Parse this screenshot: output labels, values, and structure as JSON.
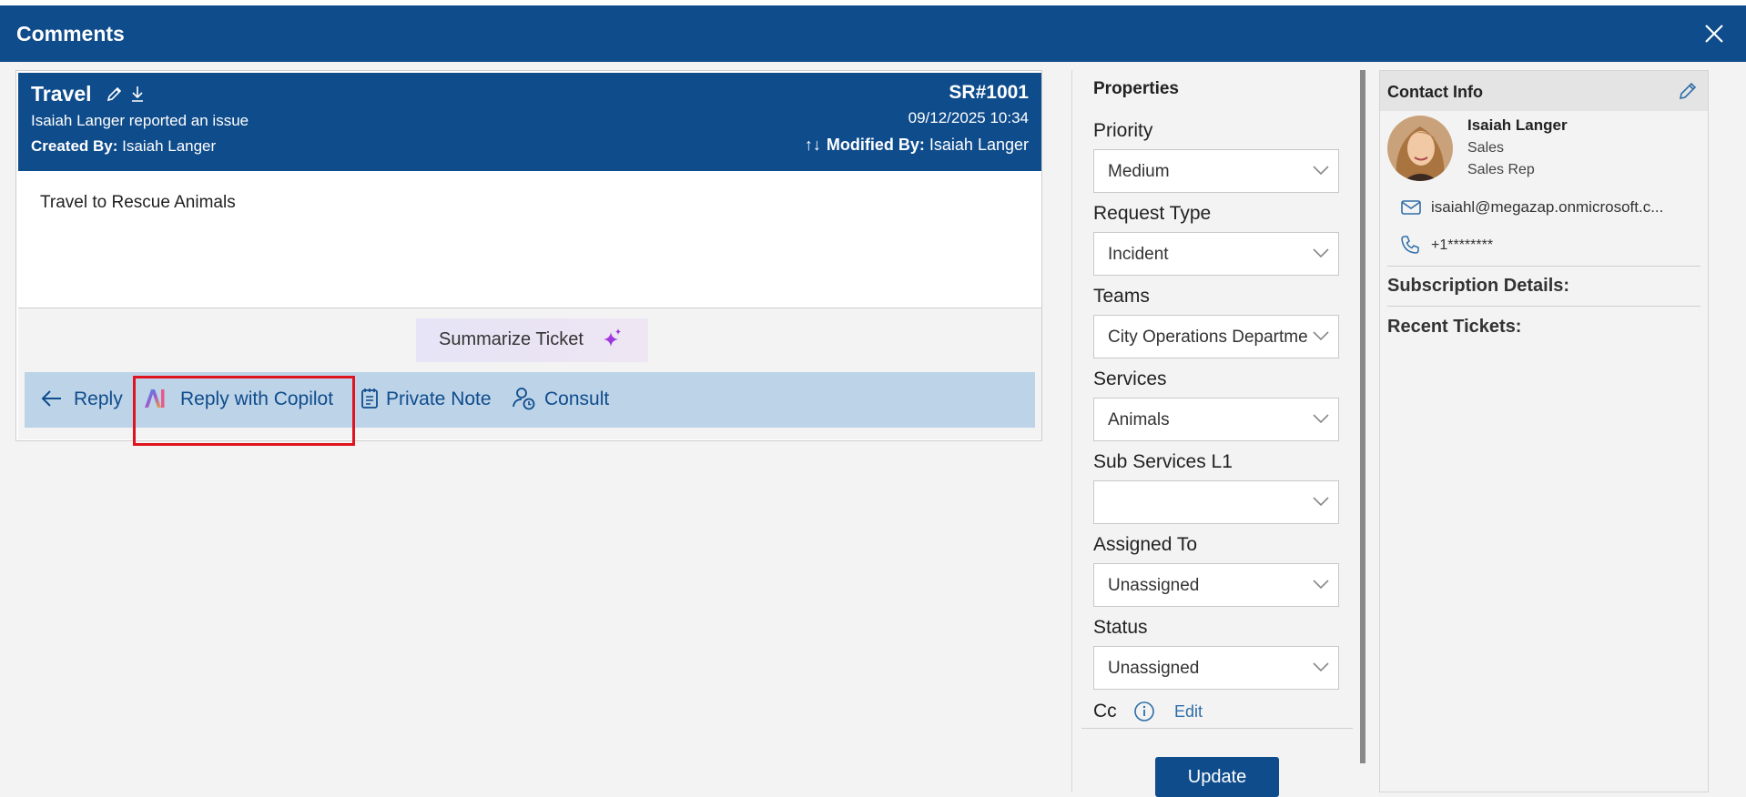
{
  "dialog": {
    "title": "Comments"
  },
  "ticket": {
    "title": "Travel",
    "reported": "Isaiah Langer reported an issue",
    "created_label": "Created By:",
    "created_by": "Isaiah Langer",
    "sr": "SR#1001",
    "date": "09/12/2025 10:34",
    "sort_arrows": "↑↓",
    "modified_label": "Modified By:",
    "modified_by": "Isaiah Langer",
    "description": "Travel to Rescue Animals",
    "summarize_label": "Summarize Ticket"
  },
  "actions": {
    "reply": "Reply",
    "reply_copilot": "Reply with Copilot",
    "private_note": "Private Note",
    "consult": "Consult"
  },
  "properties": {
    "heading": "Properties",
    "fields": [
      {
        "label": "Priority",
        "value": "Medium"
      },
      {
        "label": "Request Type",
        "value": "Incident"
      },
      {
        "label": "Teams",
        "value": "City Operations Departme"
      },
      {
        "label": "Services",
        "value": "Animals"
      },
      {
        "label": "Sub Services L1",
        "value": ""
      },
      {
        "label": "Assigned To",
        "value": "Unassigned"
      },
      {
        "label": "Status",
        "value": "Unassigned"
      }
    ],
    "cc_label": "Cc",
    "cc_edit": "Edit",
    "update_label": "Update"
  },
  "contact": {
    "heading": "Contact Info",
    "name": "Isaiah Langer",
    "department": "Sales",
    "role": "Sales Rep",
    "email": "isaiahl@megazap.onmicrosoft.c...",
    "phone": "+1********",
    "subscription_label": "Subscription Details:",
    "recent_label": "Recent Tickets:"
  },
  "colors": {
    "brand": "#0f4c8c",
    "action_bar": "#bdd3e8",
    "highlight": "#e0141e"
  }
}
